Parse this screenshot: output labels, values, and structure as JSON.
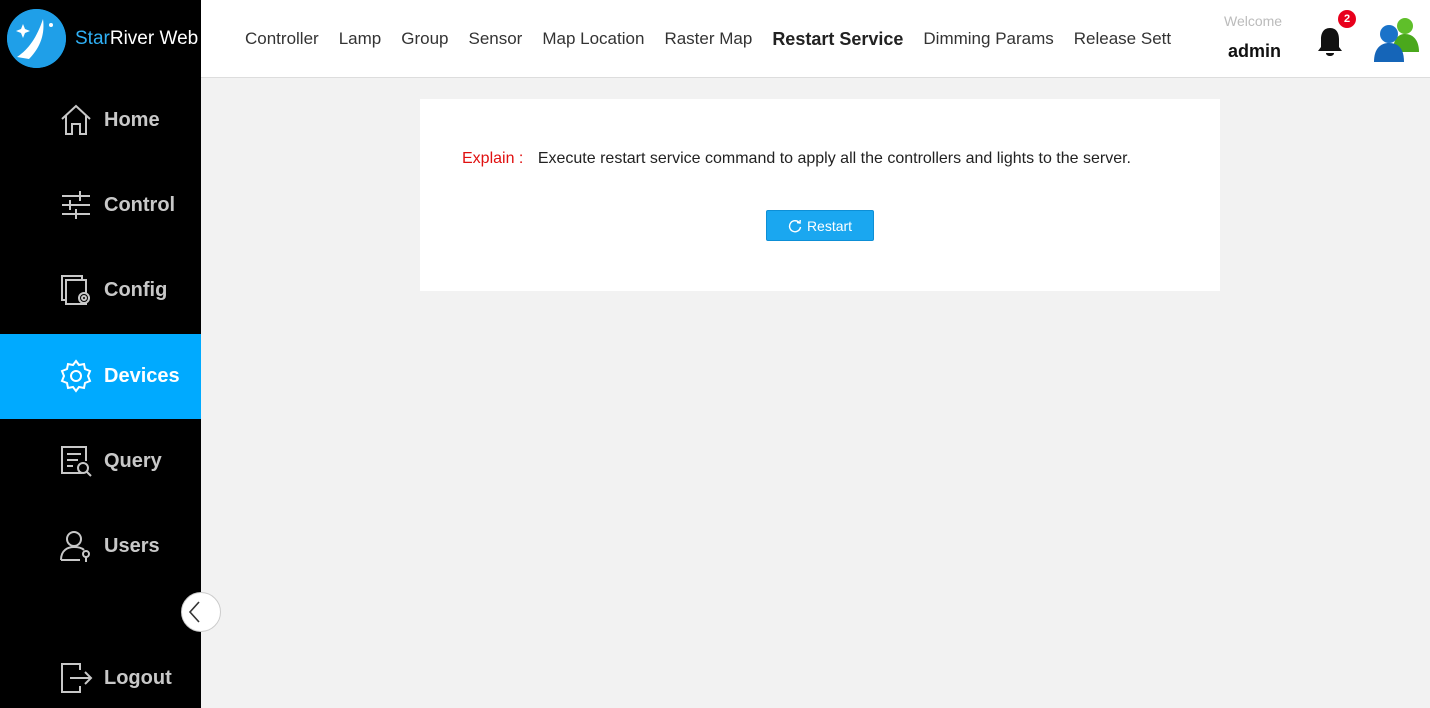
{
  "app": {
    "brand_part1": "Star",
    "brand_part2": "River Web"
  },
  "sidebar": {
    "items": [
      {
        "label": "Home",
        "icon": "home-icon"
      },
      {
        "label": "Control",
        "icon": "sliders-icon"
      },
      {
        "label": "Config",
        "icon": "config-icon"
      },
      {
        "label": "Devices",
        "icon": "gear-icon",
        "active": true
      },
      {
        "label": "Query",
        "icon": "query-icon"
      },
      {
        "label": "Users",
        "icon": "user-icon"
      }
    ],
    "logout_label": "Logout"
  },
  "tabs": [
    {
      "label": "Controller"
    },
    {
      "label": "Lamp"
    },
    {
      "label": "Group"
    },
    {
      "label": "Sensor"
    },
    {
      "label": "Map Location"
    },
    {
      "label": "Raster Map"
    },
    {
      "label": "Restart Service",
      "active": true
    },
    {
      "label": "Dimming Params"
    },
    {
      "label": "Release Sett"
    }
  ],
  "header": {
    "welcome": "Welcome",
    "username": "admin",
    "notification_count": "2"
  },
  "main": {
    "explain_label": "Explain :",
    "explain_text": "Execute restart service command to apply all the controllers and lights to the server.",
    "restart_label": "Restart"
  },
  "colors": {
    "accent": "#00aaff",
    "sidebar_bg": "#000000",
    "explain_label": "#e01010",
    "badge": "#e8001c"
  }
}
